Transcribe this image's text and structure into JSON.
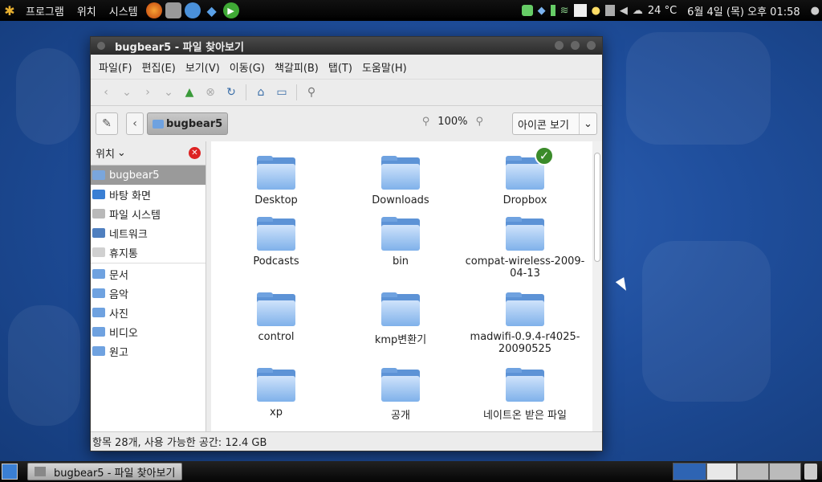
{
  "top_panel": {
    "menus": [
      "프로그램",
      "위치",
      "시스템"
    ],
    "temperature": "24 °C",
    "clock": "6월  4일 (목) 오후 01:58",
    "launcher_icons": [
      "firefox-icon",
      "hardware-icon",
      "people-icon",
      "dropbox-icon",
      "play-icon"
    ],
    "tray_icons": [
      "chat-icon",
      "dropbox-icon",
      "battery-icon",
      "wifi-icon",
      "app-icon",
      "bulb-icon",
      "device-icon",
      "volume-icon",
      "weather-icon",
      "user-icon"
    ]
  },
  "window": {
    "title": "bugbear5 - 파일 찾아보기",
    "menubar": [
      "파일(F)",
      "편집(E)",
      "보기(V)",
      "이동(G)",
      "책갈피(B)",
      "탭(T)",
      "도움말(H)"
    ],
    "location": {
      "crumb": "bugbear5",
      "zoom": "100%",
      "view_mode": "아이콘 보기"
    },
    "sidebar": {
      "header": "위치",
      "places": [
        {
          "label": "bugbear5",
          "icon": "home-folder-icon",
          "color": "#7aa6dc",
          "selected": true
        },
        {
          "label": "바탕 화면",
          "icon": "desktop-icon",
          "color": "#3a7fd4",
          "selected": false
        },
        {
          "label": "파일 시스템",
          "icon": "drive-icon",
          "color": "#b9b9b9",
          "selected": false
        },
        {
          "label": "네트워크",
          "icon": "network-icon",
          "color": "#4f7fbf",
          "selected": false
        },
        {
          "label": "휴지통",
          "icon": "trash-icon",
          "color": "#d0d0d0",
          "selected": false
        }
      ],
      "bookmarks": [
        {
          "label": "문서",
          "icon": "folder-icon",
          "color": "#6fa2e0"
        },
        {
          "label": "음악",
          "icon": "folder-icon",
          "color": "#6fa2e0"
        },
        {
          "label": "사진",
          "icon": "folder-icon",
          "color": "#6fa2e0"
        },
        {
          "label": "비디오",
          "icon": "folder-icon",
          "color": "#6fa2e0"
        },
        {
          "label": "원고",
          "icon": "folder-icon",
          "color": "#6fa2e0"
        }
      ]
    },
    "files": [
      {
        "name": "Desktop"
      },
      {
        "name": "Downloads"
      },
      {
        "name": "Dropbox",
        "badge": true
      },
      {
        "name": "Podcasts"
      },
      {
        "name": "bin"
      },
      {
        "name": "compat-wireless-2009-04-13"
      },
      {
        "name": "control"
      },
      {
        "name": "kmp변환기"
      },
      {
        "name": "madwifi-0.9.4-r4025-20090525"
      },
      {
        "name": "xp"
      },
      {
        "name": "공개"
      },
      {
        "name": "네이트온 받은 파일"
      }
    ],
    "status": "항목 28개, 사용 가능한 공간: 12.4 GB"
  },
  "bottom_panel": {
    "task_label": "bugbear5 - 파일 찾아보기"
  }
}
